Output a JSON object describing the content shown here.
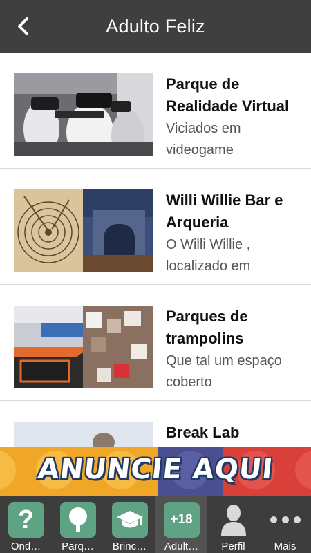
{
  "header": {
    "title": "Adulto Feliz",
    "back_icon": "chevron-left-icon"
  },
  "items": [
    {
      "title": "Parque de Realidade Virtual",
      "description": "Viciados em videogame"
    },
    {
      "title": "Willi Willie Bar e Arqueria",
      "description": "O  Willi Willie , localizado em"
    },
    {
      "title": "Parques de trampolins",
      "description": "Que tal um espaço coberto"
    },
    {
      "title": "Break Lab",
      "description": ""
    }
  ],
  "ad": {
    "text": "ANUNCIE AQUI"
  },
  "nav": [
    {
      "label": "Ond…",
      "icon": "question-icon"
    },
    {
      "label": "Parq…",
      "icon": "tree-icon"
    },
    {
      "label": "Brinc…",
      "icon": "graduation-cap-icon"
    },
    {
      "label": "Adult…",
      "icon": "plus-18-icon",
      "icon_text": "+18",
      "active": true
    },
    {
      "label": "Perfil",
      "icon": "user-icon"
    },
    {
      "label": "Mais",
      "icon": "more-dots-icon"
    }
  ],
  "colors": {
    "header_bg": "#3f3f3f",
    "nav_bg": "#3d3d3d",
    "nav_icon_bg": "#5fa385",
    "ad_bg": "#f0a626"
  }
}
